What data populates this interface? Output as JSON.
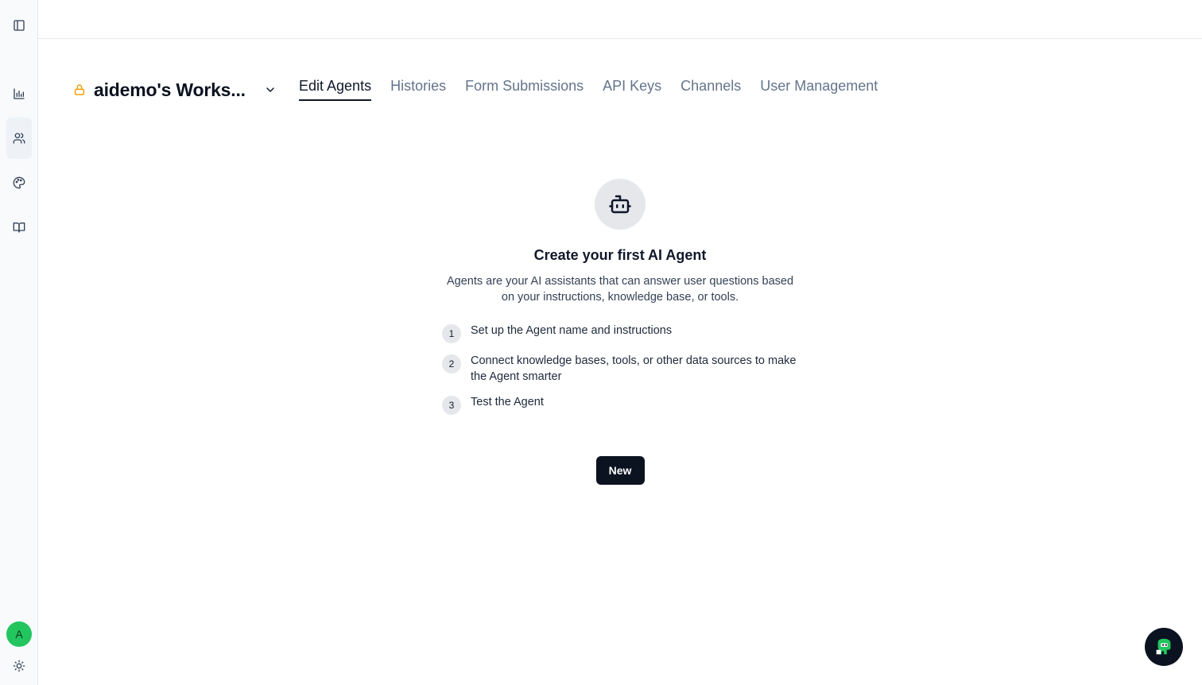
{
  "sidebar": {
    "items": [
      {
        "icon": "sidebar-toggle-icon"
      },
      {
        "icon": "bar-chart-icon"
      },
      {
        "icon": "users-icon",
        "active": true
      },
      {
        "icon": "palette-icon"
      },
      {
        "icon": "book-icon"
      }
    ],
    "avatar_initial": "A",
    "avatar_color": "#22c55e",
    "theme_icon": "sun-icon"
  },
  "header": {
    "workspace_name": "aidemo's Works...",
    "lock_color": "#f59e0b",
    "tabs": [
      {
        "label": "Edit Agents",
        "active": true
      },
      {
        "label": "Histories"
      },
      {
        "label": "Form Submissions"
      },
      {
        "label": "API Keys"
      },
      {
        "label": "Channels"
      },
      {
        "label": "User Management"
      }
    ]
  },
  "empty_state": {
    "icon": "bot-icon",
    "title": "Create your first AI Agent",
    "description": "Agents are your AI assistants that can answer user questions based on your instructions, knowledge base, or tools.",
    "steps": [
      {
        "num": "1",
        "text": "Set up the Agent name and instructions"
      },
      {
        "num": "2",
        "text": "Connect knowledge bases, tools, or other data sources to make the Agent smarter"
      },
      {
        "num": "3",
        "text": "Test the Agent"
      }
    ],
    "button_label": "New"
  },
  "chat_widget": {
    "icon": "chat-mascot-icon",
    "accent_color": "#22c55e"
  }
}
